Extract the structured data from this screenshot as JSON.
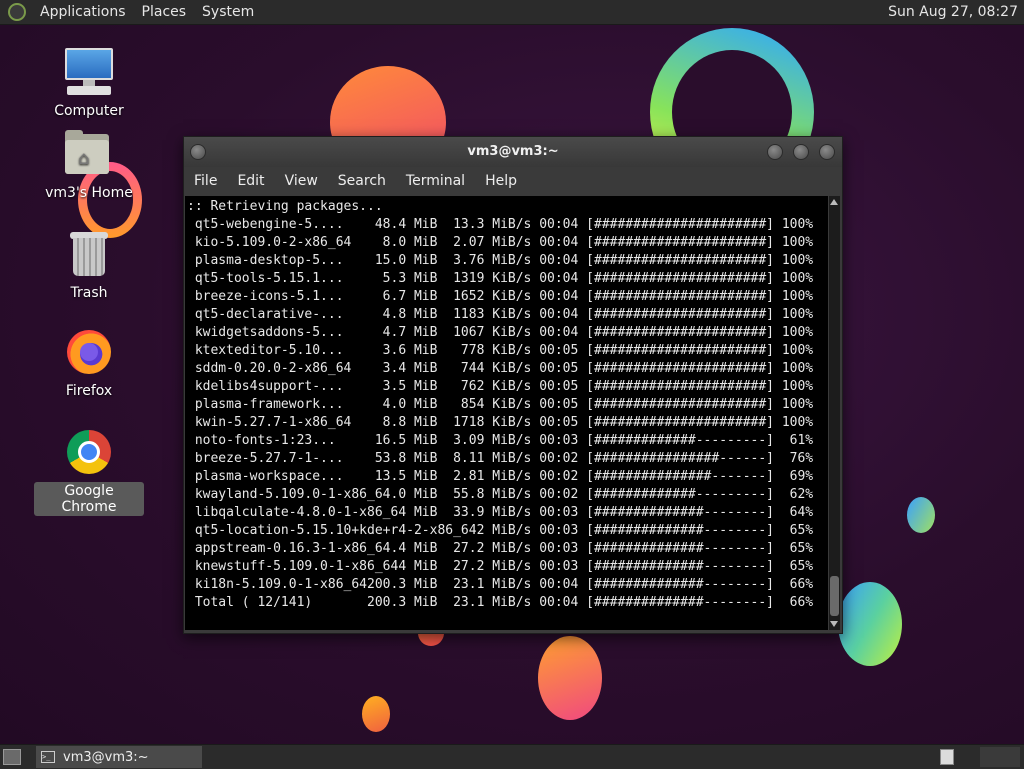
{
  "top_panel": {
    "menus": [
      "Applications",
      "Places",
      "System"
    ],
    "clock": "Sun Aug 27, 08:27"
  },
  "desktop_icons": [
    {
      "label": "Computer",
      "icon": "computer-icon"
    },
    {
      "label": "vm3's Home",
      "icon": "home-folder-icon"
    },
    {
      "label": "Trash",
      "icon": "trash-icon"
    },
    {
      "label": "Firefox",
      "icon": "firefox-icon"
    },
    {
      "label": "Google Chrome",
      "icon": "chrome-icon",
      "selected": true
    }
  ],
  "window": {
    "title": "vm3@vm3:~",
    "menus": [
      "File",
      "Edit",
      "View",
      "Search",
      "Terminal",
      "Help"
    ],
    "terminal_lines": [
      ":: Retrieving packages...",
      " qt5-webengine-5....    48.4 MiB  13.3 MiB/s 00:04 [######################] 100%",
      " kio-5.109.0-2-x86_64    8.0 MiB  2.07 MiB/s 00:04 [######################] 100%",
      " plasma-desktop-5...    15.0 MiB  3.76 MiB/s 00:04 [######################] 100%",
      " qt5-tools-5.15.1...     5.3 MiB  1319 KiB/s 00:04 [######################] 100%",
      " breeze-icons-5.1...     6.7 MiB  1652 KiB/s 00:04 [######################] 100%",
      " qt5-declarative-...     4.8 MiB  1183 KiB/s 00:04 [######################] 100%",
      " kwidgetsaddons-5...     4.7 MiB  1067 KiB/s 00:04 [######################] 100%",
      " ktexteditor-5.10...     3.6 MiB   778 KiB/s 00:05 [######################] 100%",
      " sddm-0.20.0-2-x86_64    3.4 MiB   744 KiB/s 00:05 [######################] 100%",
      " kdelibs4support-...     3.5 MiB   762 KiB/s 00:05 [######################] 100%",
      " plasma-framework...     4.0 MiB   854 KiB/s 00:05 [######################] 100%",
      " kwin-5.27.7-1-x86_64    8.8 MiB  1718 KiB/s 00:05 [######################] 100%",
      " noto-fonts-1:23...     16.5 MiB  3.09 MiB/s 00:03 [#############---------]  61%",
      " breeze-5.27.7-1-...    53.8 MiB  8.11 MiB/s 00:02 [################------]  76%",
      " plasma-workspace...    13.5 MiB  2.81 MiB/s 00:02 [###############-------]  69%",
      " kwayland-5.109.0-1-x86_64.0 MiB  55.8 MiB/s 00:02 [#############---------]  62%",
      " libqalculate-4.8.0-1-x86_64 MiB  33.9 MiB/s 00:03 [##############--------]  64%",
      " qt5-location-5.15.10+kde+r4-2-x86_642 MiB/s 00:03 [##############--------]  65%",
      " appstream-0.16.3-1-x86_64.4 MiB  27.2 MiB/s 00:03 [##############--------]  65%",
      " knewstuff-5.109.0-1-x86_644 MiB  27.2 MiB/s 00:03 [##############--------]  65%",
      " ki18n-5.109.0-1-x86_64200.3 MiB  23.1 MiB/s 00:04 [##############--------]  66%",
      " Total ( 12/141)       200.3 MiB  23.1 MiB/s 00:04 [##############--------]  66%"
    ]
  },
  "taskbar": {
    "task_label": "vm3@vm3:~"
  }
}
